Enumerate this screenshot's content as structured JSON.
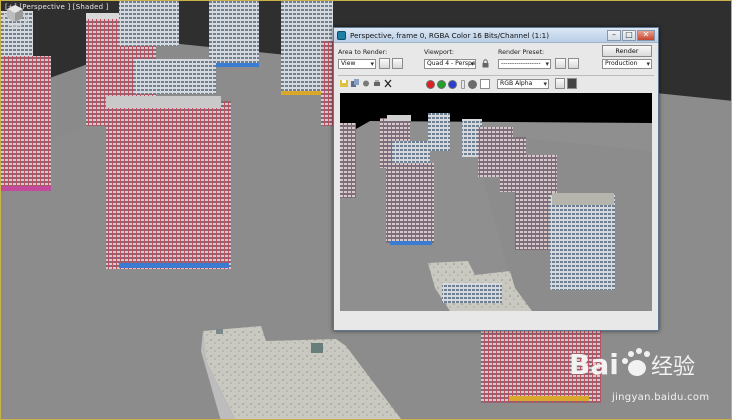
{
  "viewport": {
    "label": "[+] [Perspective ] [Shaded ]"
  },
  "render_window": {
    "title": "Perspective, frame 0, RGBA Color 16 Bits/Channel (1:1)",
    "window_buttons": {
      "minimize": "–",
      "maximize": "□",
      "close": "✕"
    },
    "area_to_render": {
      "label": "Area to Render:",
      "value": "View"
    },
    "viewport_select": {
      "label": "Viewport:",
      "value": "Quad 4 - Perspec"
    },
    "render_preset": {
      "label": "Render Preset:",
      "value": "------------------"
    },
    "render_button": "Render",
    "production": "Production",
    "channel_select": "RGB Alpha"
  },
  "watermark": {
    "text": "jingyan.baidu.com"
  }
}
